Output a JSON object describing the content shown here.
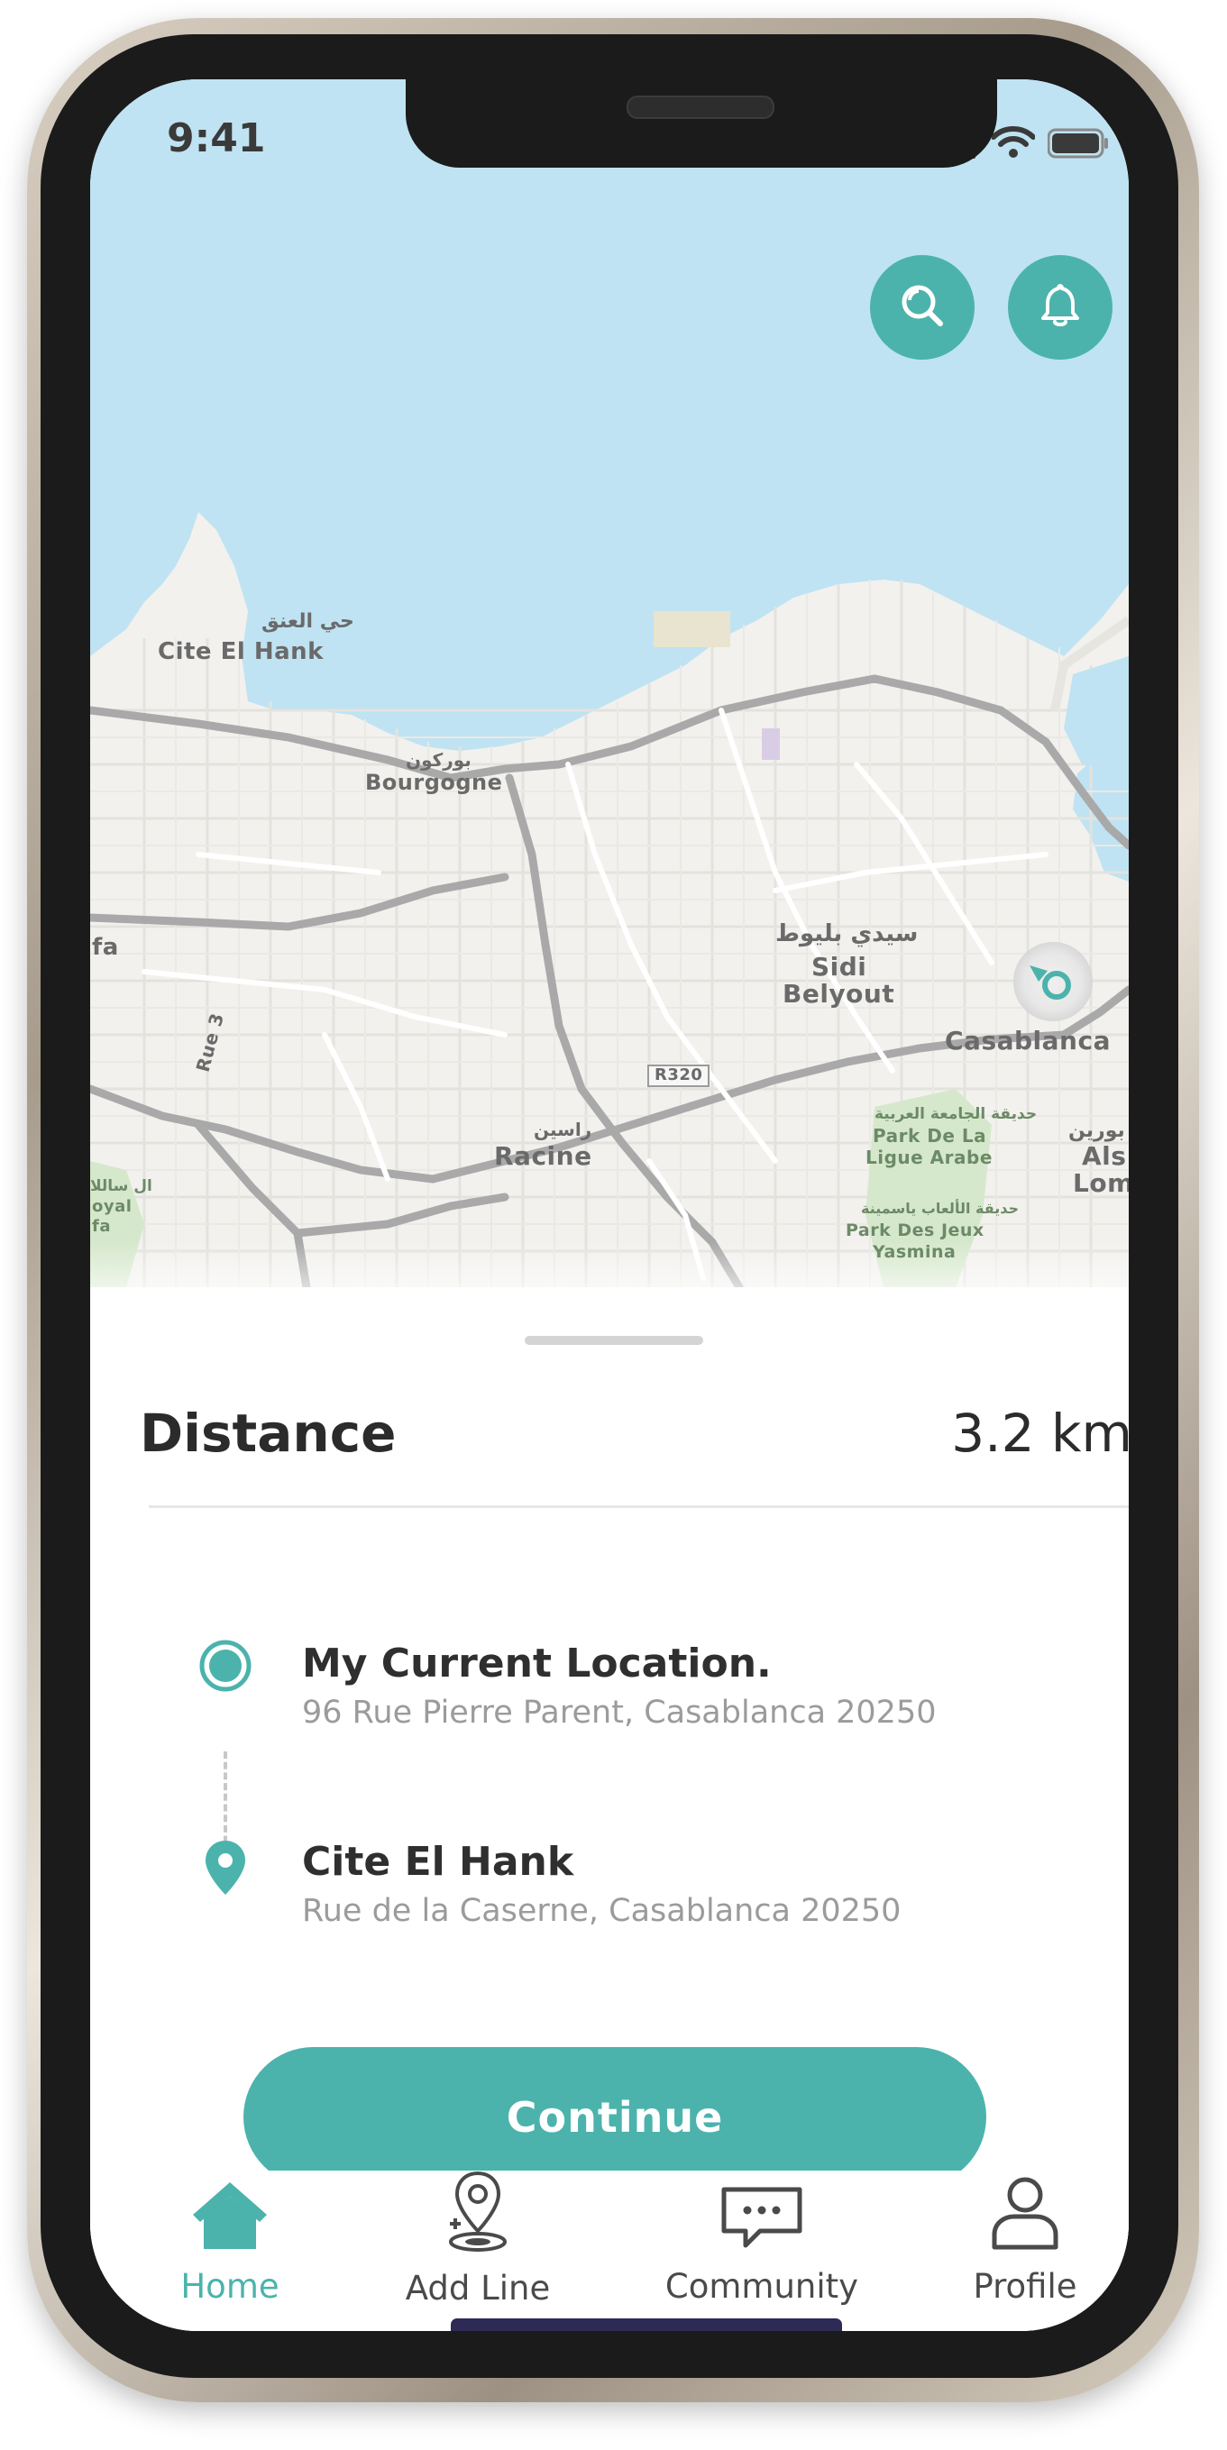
{
  "status_bar": {
    "time": "9:41"
  },
  "map": {
    "labels": {
      "cite_el_hank_ar": "حي العنق",
      "cite_el_hank": "Cite El Hank",
      "bourgogne_ar": "بوركون",
      "bourgogne": "Bourgogne",
      "sidi_belyout_ar": "سيدي بليوط",
      "sidi_belyout_1": "Sidi",
      "sidi_belyout_2": "Belyout",
      "casablanca": "Casablanca",
      "racine_ar": "راسين",
      "racine": "Racine",
      "park_ligue_ar": "حديقة الجامعة العربية",
      "park_ligue_1": "Park De La",
      "park_ligue_2": "Ligue Arabe",
      "park_jeux_ar": "حديقة الألعاب ياسمينة",
      "park_jeux_1": "Park Des Jeux",
      "park_jeux_2": "Yasmina",
      "route": "R320",
      "rue3": "Rue 3",
      "als_ar": "بورين",
      "als_1": "Als",
      "als_2": "Lom",
      "fa": "fa",
      "left_edge_ar": "ال ساللا",
      "left_edge_1": "oyal",
      "left_edge_2": "fa"
    },
    "buttons": {
      "search_icon": "search-icon",
      "bell_icon": "bell-icon"
    }
  },
  "sheet": {
    "distance_label": "Distance",
    "distance_value": "3.2 km",
    "origin": {
      "title": "My Current Location.",
      "address": "96 Rue Pierre Parent, Casablanca 20250"
    },
    "destination": {
      "title": "Cite El Hank",
      "address": "Rue de la Caserne, Casablanca 20250"
    },
    "continue_label": "Continue"
  },
  "tab_bar": {
    "tabs": [
      {
        "label": "Home",
        "icon": "home-icon",
        "active": true
      },
      {
        "label": "Add Line",
        "icon": "map-pin-plus-icon",
        "active": false
      },
      {
        "label": "Community",
        "icon": "chat-bubble-icon",
        "active": false
      },
      {
        "label": "Profile",
        "icon": "user-icon",
        "active": false
      }
    ]
  },
  "colors": {
    "accent": "#4bb3ac",
    "text_dark": "#2b2b2b",
    "text_muted": "#9b9b9b",
    "tab_inactive": "#4a4a4a",
    "water": "#bfe3f2",
    "land": "#f2f1ee",
    "handle": "#d4d4d4"
  }
}
